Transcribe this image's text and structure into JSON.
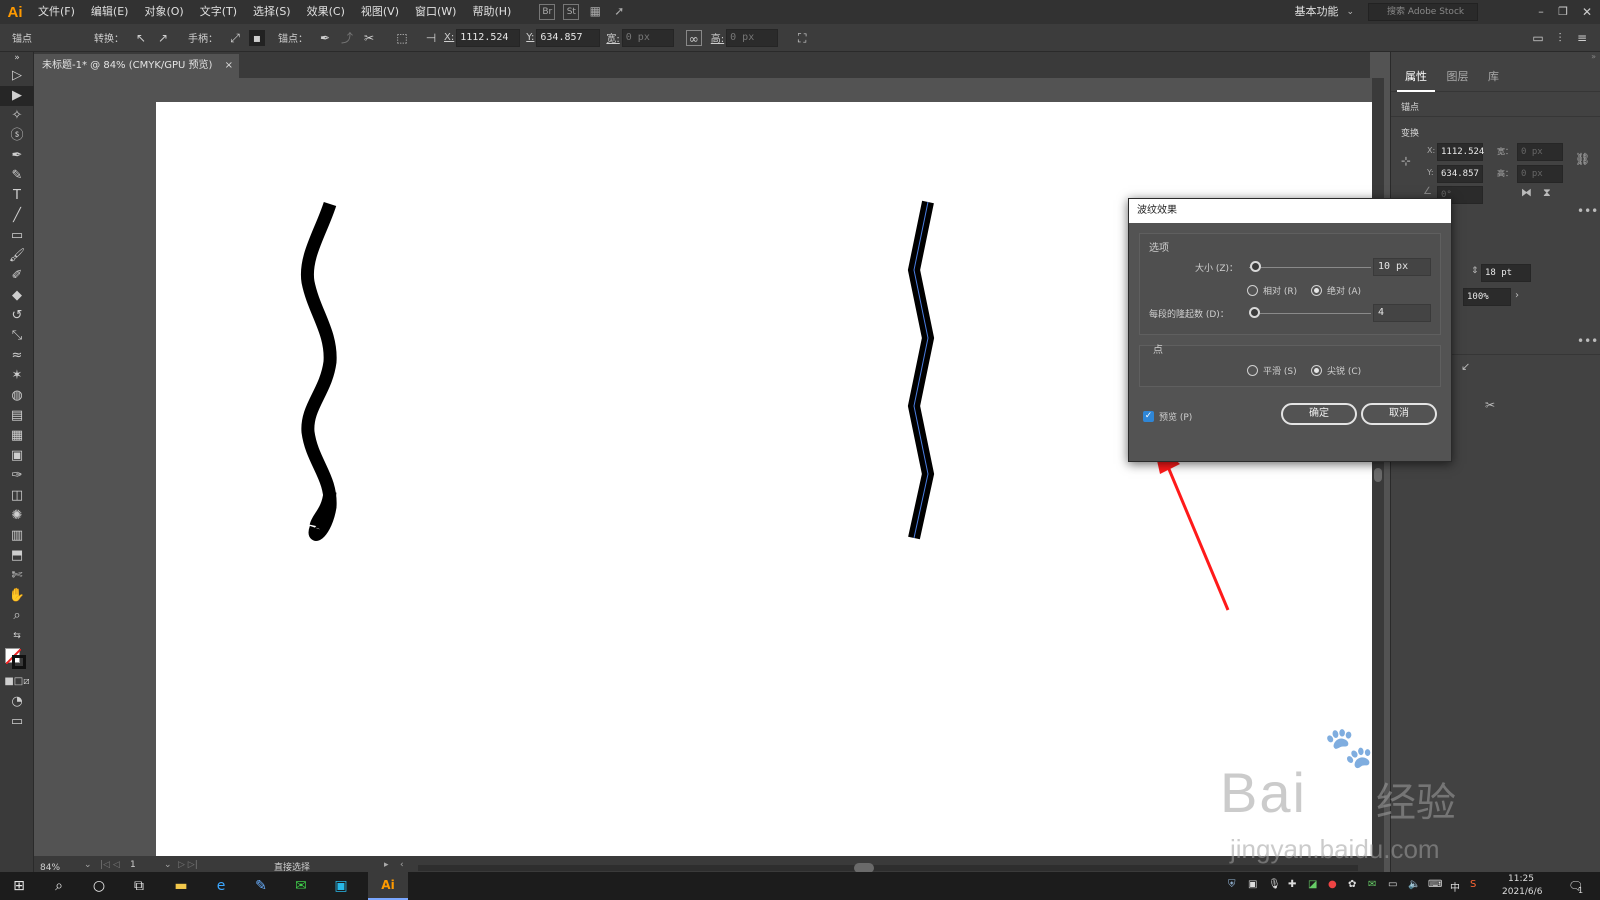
{
  "app": {
    "logo": "Ai"
  },
  "menu": [
    "文件(F)",
    "编辑(E)",
    "对象(O)",
    "文字(T)",
    "选择(S)",
    "效果(C)",
    "视图(V)",
    "窗口(W)",
    "帮助(H)"
  ],
  "menubar_right": {
    "workspace": "基本功能",
    "search_placeholder": "搜索 Adobe Stock"
  },
  "menubar_icons": {
    "br": "Br",
    "st": "St"
  },
  "control_bar": {
    "anchor_label": "锚点",
    "convert_label": "转换：",
    "handle_label": "手柄：",
    "anchor_points_label": "锚点：",
    "x_label": "X:",
    "x_value": "1112.524",
    "y_label": "Y:",
    "y_value": "634.857",
    "w_label": "宽:",
    "w_value": "0 px",
    "h_label": "高:",
    "h_value": "0 px"
  },
  "document_tab": {
    "title": "未标题-1* @ 84% (CMYK/GPU 预览)",
    "close": "×"
  },
  "status_bar": {
    "zoom": "84%",
    "artboard": "1",
    "tool": "直接选择"
  },
  "right_panel": {
    "tabs": [
      "属性",
      "图层",
      "库"
    ],
    "section_anchor": "锚点",
    "section_transform": "变换",
    "x_label": "X:",
    "x_value": "1112.524",
    "y_label": "Y:",
    "y_value": "634.857",
    "w_label": "宽：",
    "w_value": "0 px",
    "h_label": "高：",
    "h_value": "0 px",
    "angle_value": "0°",
    "stroke_size": "18 pt",
    "opacity": "100%"
  },
  "dialog": {
    "title": "波纹效果",
    "options_label": "选项",
    "size_label": "大小 (Z)：",
    "size_value": "10 px",
    "size_fraction": 0.05,
    "relative_label": "相对 (R)",
    "absolute_label": "绝对 (A)",
    "ridges_label": "每段的隆起数 (D)：",
    "ridges_value": "4",
    "ridges_fraction": 0.04,
    "points_label": "点",
    "smooth_label": "平滑 (S)",
    "corner_label": "尖锐 (C)",
    "preview_label": "预览 (P)",
    "ok_label": "确定",
    "cancel_label": "取消"
  },
  "taskbar": {
    "time": "11:25",
    "date": "2021/6/6",
    "lang": "中",
    "notif": "1",
    "ai": "Ai"
  },
  "watermark": {
    "text1": "Bai",
    "text2": "经验",
    "url": "jingyan.baidu.com"
  },
  "colors": {
    "accent_red": "#ff1a1a",
    "checkbox_blue": "#2f86d6"
  }
}
